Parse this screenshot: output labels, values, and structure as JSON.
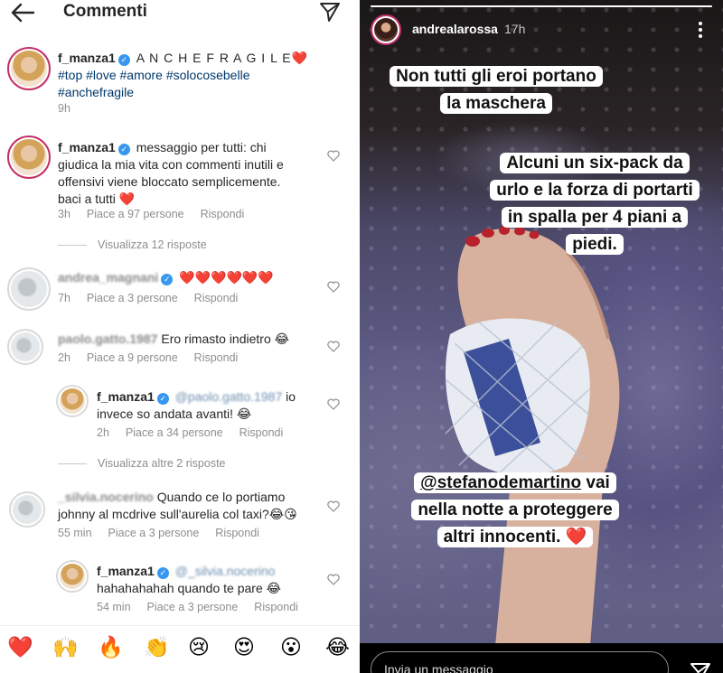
{
  "comments_panel": {
    "title": "Commenti",
    "caption": {
      "username": "f_manza1",
      "text": "A N C H E  F R A G I L E",
      "heart": "❤️",
      "hashtags": "#top #love #amore #solocosebelle",
      "hashtags2": "#anchefragile",
      "time": "9h"
    },
    "comments": [
      {
        "username": "f_manza1",
        "line1": "messaggio per tutti: chi",
        "line2": "giudica la mia vita con commenti inutili e",
        "line3": "offensivi viene bloccato semplicemente.",
        "line4": "baci a tutti ❤️",
        "time": "3h",
        "likes": "Piace a 97 persone",
        "reply": "Rispondi",
        "view_replies": "Visualizza 12 risposte"
      },
      {
        "username": "andrea_magnani",
        "text": "❤️❤️❤️❤️❤️❤️",
        "time": "7h",
        "likes": "Piace a 3 persone",
        "reply": "Rispondi"
      },
      {
        "username": "paolo.gatto.1987",
        "text": "Ero rimasto indietro 😂",
        "time": "2h",
        "likes": "Piace a 9 persone",
        "reply": "Rispondi",
        "reply_item": {
          "username": "f_manza1",
          "mention": "@paolo.gatto.1987",
          "text1": "io",
          "text2": "invece so andata avanti! 😂",
          "time": "2h",
          "likes": "Piace a 34 persone",
          "reply": "Rispondi"
        },
        "view_replies": "Visualizza altre 2 risposte"
      },
      {
        "username": "_silvia.nocerino",
        "line1": "Quando ce lo portiamo",
        "line2": "johnny al mcdrive sull'aurelia col taxi?😂😘",
        "time": "55 min",
        "likes": "Piace a 3 persone",
        "reply": "Rispondi",
        "reply_item": {
          "username": "f_manza1",
          "mention": "@_silvia.nocerino",
          "text2": "hahahahahah quando te pare 😂",
          "time": "54 min",
          "likes": "Piace a 3 persone",
          "reply": "Rispondi"
        }
      }
    ],
    "emoji_bar": [
      "❤️",
      "🙌",
      "🔥",
      "👏",
      "😢",
      "😍",
      "😮",
      "😂"
    ]
  },
  "story": {
    "username": "andrealarossa",
    "time": "17h",
    "progress": 1.0,
    "text1_line1": "Non tutti gli eroi portano",
    "text1_line2": "la maschera",
    "text2_line1": "Alcuni un six-pack da",
    "text2_line2": "urlo e la forza di portarti",
    "text2_line3": "in spalla per 4 piani a",
    "text2_line4": "piedi.",
    "text3_mention": "@stefanodemartino",
    "text3_line1_rest": " vai",
    "text3_line2": "nella notte a proteggere",
    "text3_line3": "altri innocenti. ❤️",
    "reply_placeholder": "Invia un messaggio"
  }
}
